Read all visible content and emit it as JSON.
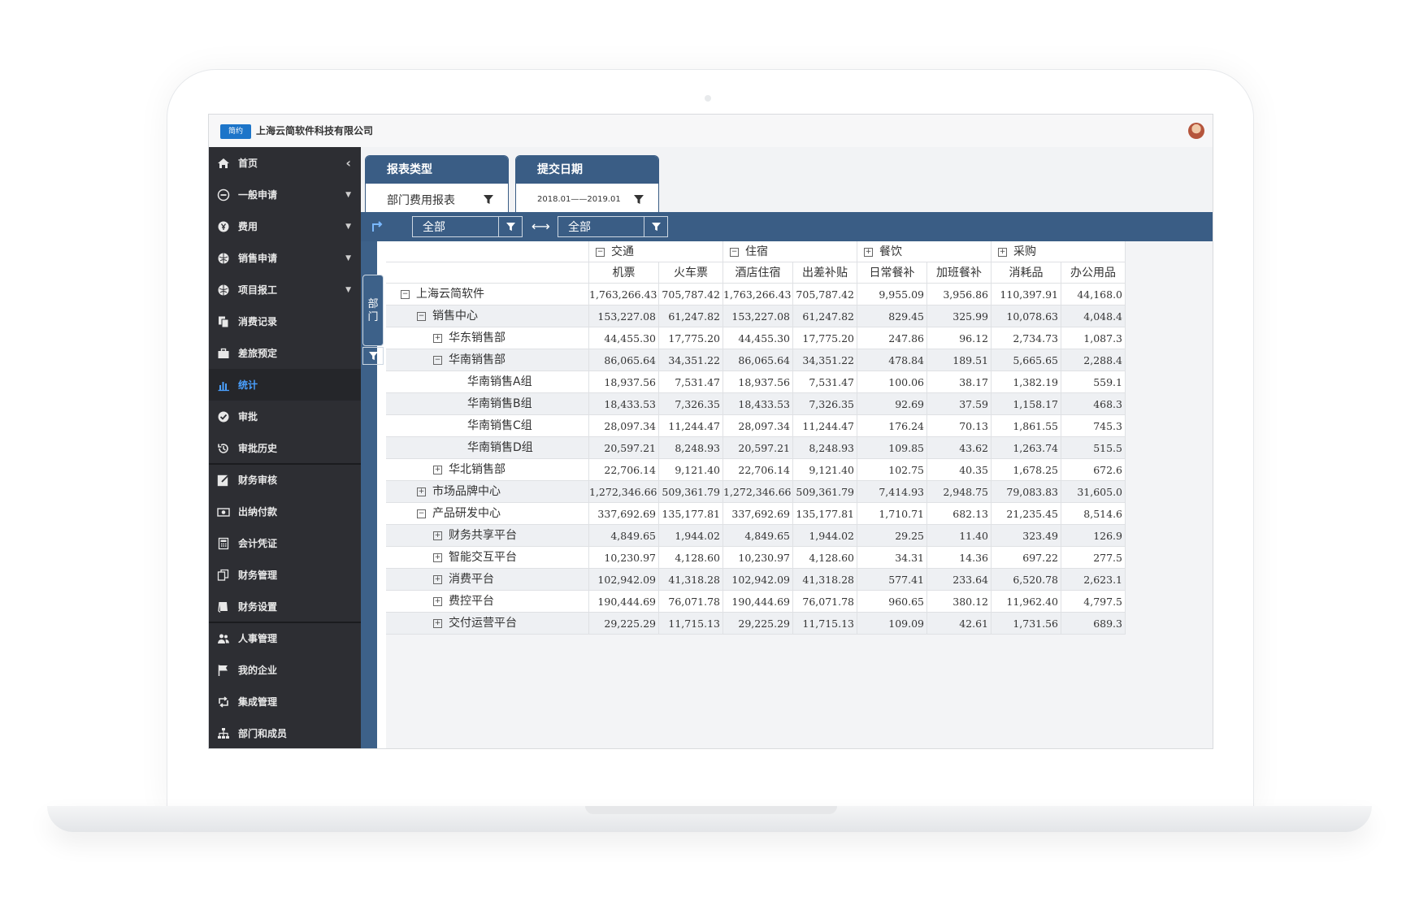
{
  "app": {
    "company": "上海云简软件科技有限公司",
    "logo_text": "简约"
  },
  "sidebar": {
    "collapse_glyph": "‹",
    "items": [
      {
        "label": "首页",
        "icon": "home-icon",
        "caret": false
      },
      {
        "label": "一般申请",
        "icon": "minus-circle-icon",
        "caret": true
      },
      {
        "label": "费用",
        "icon": "yen-circle-icon",
        "caret": true
      },
      {
        "label": "销售申请",
        "icon": "globe-icon",
        "caret": true
      },
      {
        "label": "项目报工",
        "icon": "globe-icon",
        "caret": true
      },
      {
        "label": "消费记录",
        "icon": "copy-icon",
        "caret": false
      },
      {
        "label": "差旅预定",
        "icon": "briefcase-icon",
        "caret": false
      },
      {
        "label": "统计",
        "icon": "bar-chart-icon",
        "caret": false,
        "active": true
      },
      {
        "label": "审批",
        "icon": "check-circle-icon",
        "caret": false
      },
      {
        "label": "审批历史",
        "icon": "history-icon",
        "caret": false
      },
      {
        "label": "财务审核",
        "icon": "edit-icon",
        "caret": false
      },
      {
        "label": "出纳付款",
        "icon": "money-icon",
        "caret": false
      },
      {
        "label": "会计凭证",
        "icon": "calculator-icon",
        "caret": false
      },
      {
        "label": "财务管理",
        "icon": "documents-icon",
        "caret": false
      },
      {
        "label": "财务设置",
        "icon": "book-icon",
        "caret": false
      },
      {
        "label": "人事管理",
        "icon": "users-icon",
        "caret": false
      },
      {
        "label": "我的企业",
        "icon": "flag-icon",
        "caret": false
      },
      {
        "label": "集成管理",
        "icon": "retweet-icon",
        "caret": false
      },
      {
        "label": "部门和成员",
        "icon": "sitemap-icon",
        "caret": false
      }
    ]
  },
  "filters": {
    "report_type": {
      "title": "报表类型",
      "value": "部门费用报表"
    },
    "submit_date": {
      "title": "提交日期",
      "value": "2018.01——2019.01"
    }
  },
  "toolbar": {
    "left_select": "全部",
    "right_select": "全部",
    "between": "⟷"
  },
  "dept_axis": {
    "label_1": "部",
    "label_2": "门"
  },
  "table": {
    "groups": [
      {
        "label": "交通",
        "symbol": "⊟"
      },
      {
        "label": "住宿",
        "symbol": "⊟"
      },
      {
        "label": "餐饮",
        "symbol": "⊞"
      },
      {
        "label": "采购",
        "symbol": "⊞"
      }
    ],
    "columns": [
      "机票",
      "火车票",
      "酒店住宿",
      "出差补贴",
      "日常餐补",
      "加班餐补",
      "消耗品",
      "办公用品"
    ],
    "rows": [
      {
        "label": "上海云简软件",
        "level": 0,
        "symbol": "⊟",
        "values": [
          "1,763,266.43",
          "705,787.42",
          "1,763,266.43",
          "705,787.42",
          "9,955.09",
          "3,956.86",
          "110,397.91",
          "44,168.0"
        ]
      },
      {
        "label": "销售中心",
        "level": 1,
        "symbol": "⊟",
        "values": [
          "153,227.08",
          "61,247.82",
          "153,227.08",
          "61,247.82",
          "829.45",
          "325.99",
          "10,078.63",
          "4,048.4"
        ]
      },
      {
        "label": "华东销售部",
        "level": 2,
        "symbol": "⊞",
        "values": [
          "44,455.30",
          "17,775.20",
          "44,455.30",
          "17,775.20",
          "247.86",
          "96.12",
          "2,734.73",
          "1,087.3"
        ]
      },
      {
        "label": "华南销售部",
        "level": 2,
        "symbol": "⊟",
        "values": [
          "86,065.64",
          "34,351.22",
          "86,065.64",
          "34,351.22",
          "478.84",
          "189.51",
          "5,665.65",
          "2,288.4"
        ]
      },
      {
        "label": "华南销售A组",
        "level": 3,
        "symbol": "",
        "values": [
          "18,937.56",
          "7,531.47",
          "18,937.56",
          "7,531.47",
          "100.06",
          "38.17",
          "1,382.19",
          "559.1"
        ]
      },
      {
        "label": "华南销售B组",
        "level": 3,
        "symbol": "",
        "values": [
          "18,433.53",
          "7,326.35",
          "18,433.53",
          "7,326.35",
          "92.69",
          "37.59",
          "1,158.17",
          "468.3"
        ]
      },
      {
        "label": "华南销售C组",
        "level": 3,
        "symbol": "",
        "values": [
          "28,097.34",
          "11,244.47",
          "28,097.34",
          "11,244.47",
          "176.24",
          "70.13",
          "1,861.55",
          "745.3"
        ]
      },
      {
        "label": "华南销售D组",
        "level": 3,
        "symbol": "",
        "values": [
          "20,597.21",
          "8,248.93",
          "20,597.21",
          "8,248.93",
          "109.85",
          "43.62",
          "1,263.74",
          "515.5"
        ]
      },
      {
        "label": "华北销售部",
        "level": 2,
        "symbol": "⊞",
        "values": [
          "22,706.14",
          "9,121.40",
          "22,706.14",
          "9,121.40",
          "102.75",
          "40.35",
          "1,678.25",
          "672.6"
        ]
      },
      {
        "label": "市场品牌中心",
        "level": 1,
        "symbol": "⊞",
        "values": [
          "1,272,346.66",
          "509,361.79",
          "1,272,346.66",
          "509,361.79",
          "7,414.93",
          "2,948.75",
          "79,083.83",
          "31,605.0"
        ]
      },
      {
        "label": "产品研发中心",
        "level": 1,
        "symbol": "⊟",
        "values": [
          "337,692.69",
          "135,177.81",
          "337,692.69",
          "135,177.81",
          "1,710.71",
          "682.13",
          "21,235.45",
          "8,514.6"
        ]
      },
      {
        "label": "财务共享平台",
        "level": 2,
        "symbol": "⊞",
        "values": [
          "4,849.65",
          "1,944.02",
          "4,849.65",
          "1,944.02",
          "29.25",
          "11.40",
          "323.49",
          "126.9"
        ]
      },
      {
        "label": "智能交互平台",
        "level": 2,
        "symbol": "⊞",
        "values": [
          "10,230.97",
          "4,128.60",
          "10,230.97",
          "4,128.60",
          "34.31",
          "14.36",
          "697.22",
          "277.5"
        ]
      },
      {
        "label": "消费平台",
        "level": 2,
        "symbol": "⊞",
        "values": [
          "102,942.09",
          "41,318.28",
          "102,942.09",
          "41,318.28",
          "577.41",
          "233.64",
          "6,520.78",
          "2,623.1"
        ]
      },
      {
        "label": "费控平台",
        "level": 2,
        "symbol": "⊞",
        "values": [
          "190,444.69",
          "76,071.78",
          "190,444.69",
          "76,071.78",
          "960.65",
          "380.12",
          "11,962.40",
          "4,797.5"
        ]
      },
      {
        "label": "交付运营平台",
        "level": 2,
        "symbol": "⊞",
        "values": [
          "29,225.29",
          "11,715.13",
          "29,225.29",
          "11,715.13",
          "109.09",
          "42.61",
          "1,731.56",
          "689.3"
        ]
      }
    ]
  },
  "colors": {
    "header_blue": "#3a5d85",
    "sidebar_bg": "#2d2e33",
    "active_blue": "#4aa0ff"
  }
}
